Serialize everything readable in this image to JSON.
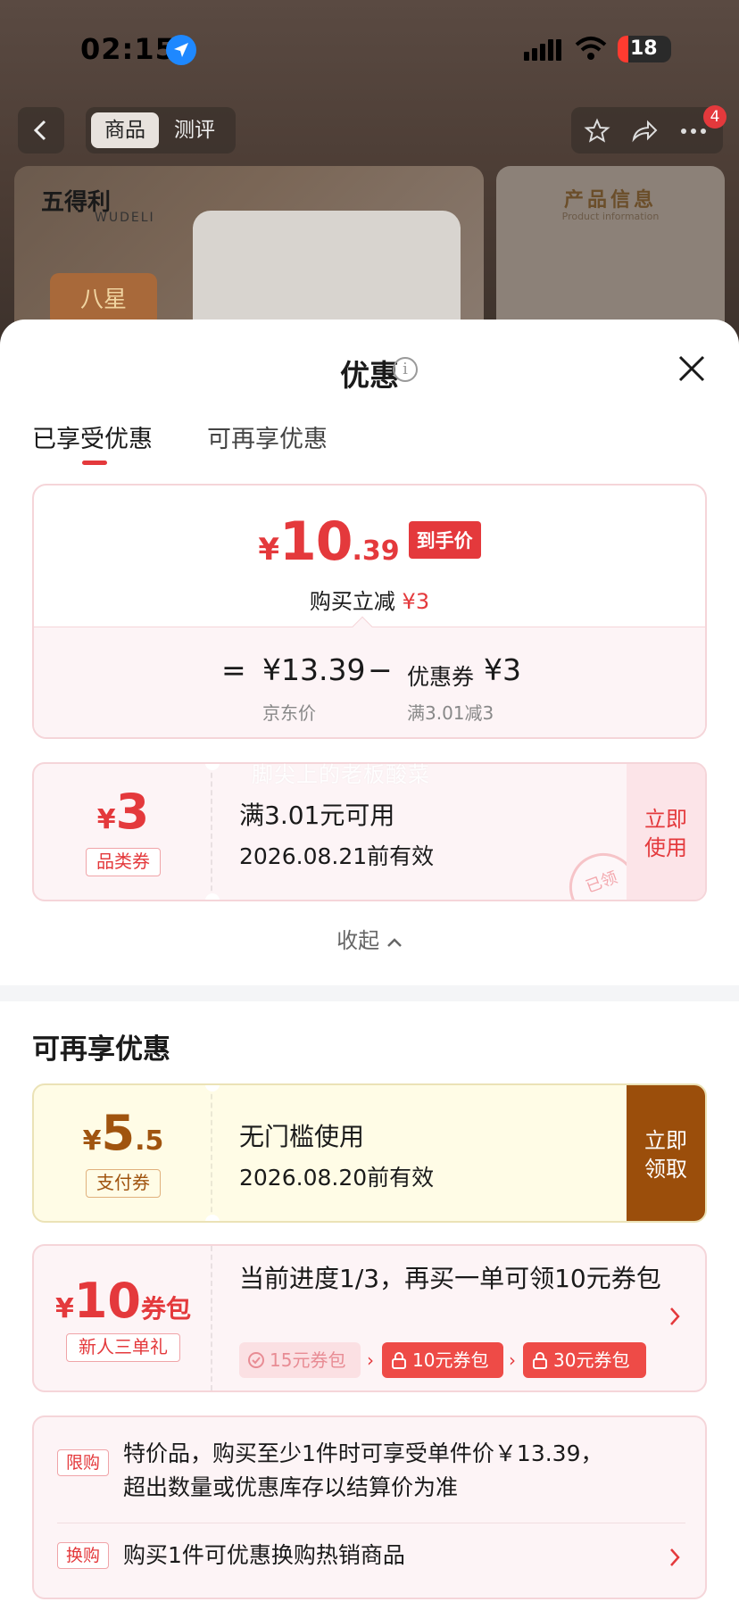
{
  "status_bar": {
    "time": "02:15",
    "battery": "18"
  },
  "product_header": {
    "tabs": [
      "商品",
      "测评"
    ],
    "cart_badge": "4",
    "brand": "五得利",
    "brand_en": "WUDELI",
    "grade": "八星",
    "info_title": "产品信息",
    "info_subtitle": "Product information"
  },
  "sheet": {
    "title": "优惠",
    "tabs": [
      "已享受优惠",
      "可再享优惠"
    ],
    "final_price": {
      "currency": "¥",
      "integer": "10",
      "decimal": ".39",
      "tag": "到手价",
      "saving_label": "购买立减",
      "saving_value": "¥3"
    },
    "formula": {
      "eq": "=",
      "jd_price": "¥13.39",
      "jd_label": "京东价",
      "minus": "−",
      "coupon_label": "优惠券",
      "coupon_value": "¥3",
      "coupon_rule": "满3.01减3"
    },
    "watermark": "脚尖上的老板酸菜",
    "applied_coupon": {
      "currency": "¥",
      "amount": "3",
      "kind": "品类券",
      "condition": "满3.01元可用",
      "expiry": "2026.08.21前有效",
      "action_line1": "立即",
      "action_line2": "使用",
      "stamp": "已领"
    },
    "collapse_label": "收起",
    "more_title": "可再享优惠",
    "pay_coupon": {
      "currency": "¥",
      "amount": "5",
      "decimal": ".5",
      "kind": "支付券",
      "condition": "无门槛使用",
      "expiry": "2026.08.20前有效",
      "action_line1": "立即",
      "action_line2": "领取"
    },
    "bundle": {
      "currency": "¥",
      "amount": "10",
      "suffix": "券包",
      "kind": "新人三单礼",
      "description": "当前进度1/3，再买一单可领10元券包",
      "chips": [
        "15元券包",
        "10元券包",
        "30元券包"
      ]
    },
    "rules": [
      {
        "tag": "限购",
        "text": "特价品，购买至少1件时可享受单件价￥13.39，超出数量或优惠库存以结算价为准"
      },
      {
        "tag": "换购",
        "text": "购买1件可优惠换购热销商品"
      }
    ]
  },
  "colors": {
    "accent_red": "#e4393c",
    "pay_brown": "#9b4e0b"
  }
}
